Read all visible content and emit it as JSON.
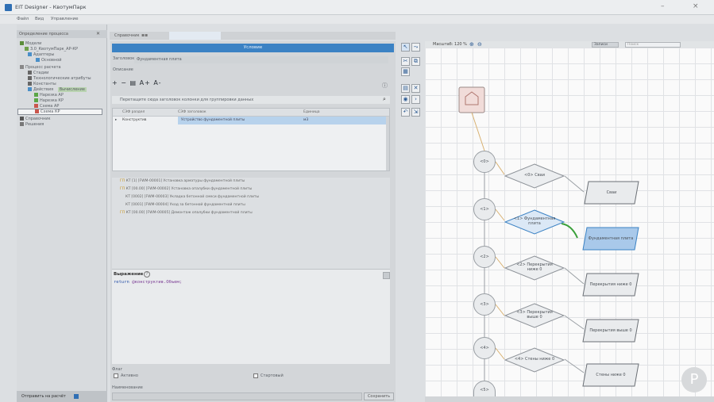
{
  "window": {
    "title": "EIT Designer - КвотумПарк"
  },
  "menu": [
    "Файл",
    "Вид",
    "Управление"
  ],
  "left_panel": {
    "header": "Определение процесса",
    "tree": [
      "Модели",
      "3.0_КвотумПарк_АР-КР",
      "Адаптеры",
      "Основной",
      "Процесс расчета",
      "Стадии",
      "Технологические атрибуты",
      "Константы",
      "Действия",
      "Нарезка АР",
      "Нарезка КР",
      "Схема АР",
      "Схема КР",
      "Справочник",
      "Решения"
    ],
    "selected_badge": "Вычисление",
    "bottom_button": "Отправить на расчёт"
  },
  "tabs": {
    "active": "Справочник"
  },
  "mid": {
    "header": "Условие",
    "field1_label": "Заголовок",
    "field1_value": "Фундаментная плита",
    "field2_label": "Описание",
    "toolbar": "+ − ▤ A+ A-",
    "filter_placeholder": "Перетащите сюда заголовок колонки для группировки данных",
    "grid_headers": [
      "СЭФ раздел",
      "СЭФ заголовок",
      "Единица"
    ],
    "grid_row": [
      "Конструктив",
      "Устройство фундаментной плиты",
      "м3"
    ],
    "log": [
      {
        "tag": "ГП",
        "text": "КТ [1] [FWM-00001] Установка арматуры фундаментной плиты"
      },
      {
        "tag": "ГП",
        "text": "КТ [00.00] [FWM-00002] Установка опалубки фундаментной плиты"
      },
      {
        "tag": "",
        "text": "КТ [0002] [FWM-00003] Укладка бетонной смеси фундаментной плиты"
      },
      {
        "tag": "",
        "text": "КТ [0001] [FWM-00004] Уход за бетонной фундаментной плиты"
      },
      {
        "tag": "ГП",
        "text": "КТ [00.00] [FWM-00005] Демонтаж опалубки фундаментной плиты"
      }
    ],
    "code_label": "Выражение",
    "code": {
      "kw": "return",
      "var": "@конструктив.Объем;"
    },
    "active_label": "Активно",
    "start_label": "Стартовый",
    "name_label": "Наименование",
    "save_button": "Сохранить"
  },
  "canvas": {
    "zoom_label": "Масштаб: 120 %",
    "select1": "Записи",
    "select2": "Поиск",
    "start_nodes": [
      "<0>",
      "<1>",
      "<2>",
      "<3>",
      "<4>",
      "<5>"
    ],
    "decisions": [
      "<0> Сваи",
      "<1> Фундаментная плита",
      "<2> Перекрытия ниже 0",
      "<3> Перекрытия выше 0",
      "<4> Стены ниже 0"
    ],
    "results": [
      "Сваи",
      "Фундаментная плита",
      "Перекрытия ниже 0",
      "Перекрытия выше 0",
      "Стены ниже 0"
    ]
  },
  "fab_label": "P"
}
